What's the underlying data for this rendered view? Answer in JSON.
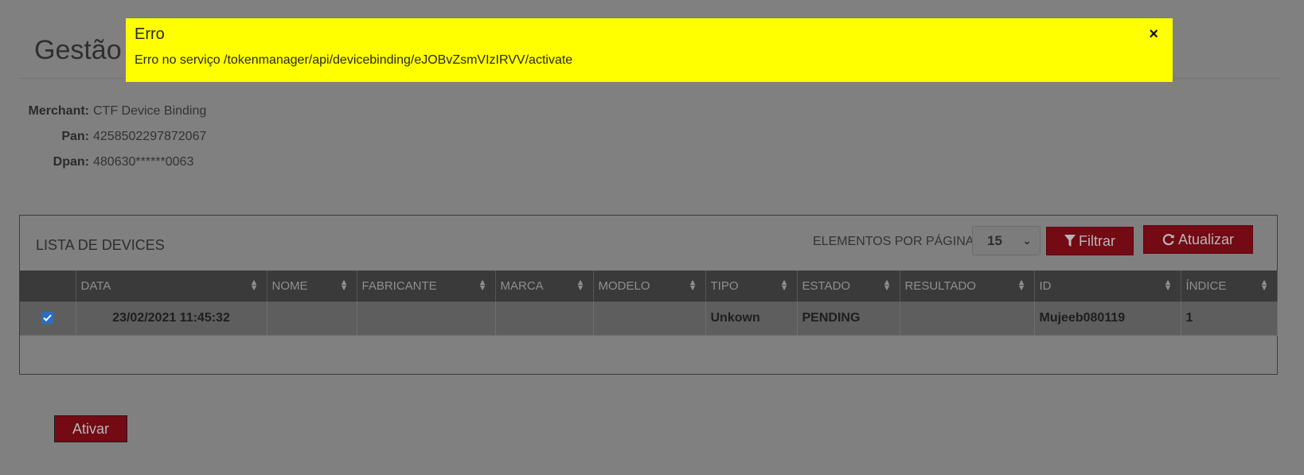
{
  "header": {
    "title": "Gestão"
  },
  "info": [
    {
      "label": "Merchant:",
      "value": "CTF Device Binding"
    },
    {
      "label": "Pan:",
      "value": "4258502297872067"
    },
    {
      "label": "Dpan:",
      "value": "480630******0063"
    }
  ],
  "panel": {
    "title": "LISTA DE DEVICES",
    "per_page_label": "ELEMENTOS POR PÁGINA:",
    "per_page_value": "15",
    "filter_label": "Filtrar",
    "refresh_label": "Atualizar"
  },
  "table": {
    "columns": [
      "DATA",
      "NOME",
      "FABRICANTE",
      "MARCA",
      "MODELO",
      "TIPO",
      "ESTADO",
      "RESULTADO",
      "ID",
      "ÍNDICE"
    ],
    "rows": [
      {
        "checked": true,
        "cells": [
          "23/02/2021 11:45:32",
          "",
          "",
          "",
          "",
          "Unkown",
          "PENDING",
          "",
          "Mujeeb080119",
          "1"
        ]
      }
    ]
  },
  "actions": {
    "activate_label": "Ativar"
  },
  "alert": {
    "title": "Erro",
    "message": "Erro no serviço /tokenmanager/api/devicebinding/eJOBvZsmVIzIRVV/activate",
    "close_icon": "×"
  },
  "colors": {
    "alert_bg": "#ffff00",
    "button_bg": "#730a14",
    "overlay": "#808080"
  }
}
